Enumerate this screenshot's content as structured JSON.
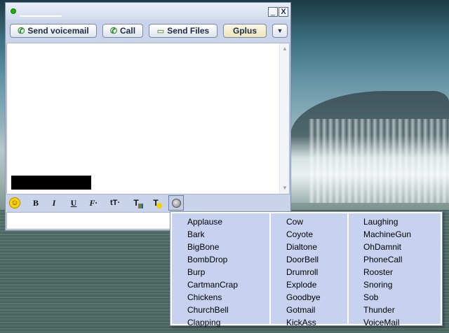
{
  "window": {
    "status": "online",
    "buttons": {
      "voicemail": "Send voicemail",
      "call": "Call",
      "files": "Send Files",
      "gplus": "Gplus",
      "more": "▼"
    },
    "window_controls": {
      "minimize": "_",
      "close": "X"
    }
  },
  "format_bar": {
    "bold": "B",
    "italic": "I",
    "underline": "U",
    "font": "F",
    "size": "tT",
    "text_color": "T",
    "bg_color": "T"
  },
  "sound_menu": {
    "col1": [
      "Applause",
      "Bark",
      "BigBone",
      "BombDrop",
      "Burp",
      "CartmanCrap",
      "Chickens",
      "ChurchBell",
      "Clapping"
    ],
    "col2": [
      "Cow",
      "Coyote",
      "Dialtone",
      "DoorBell",
      "Drumroll",
      "Explode",
      "Goodbye",
      "Gotmail",
      "KickAss"
    ],
    "col3": [
      "Laughing",
      "MachineGun",
      "OhDamnit",
      "PhoneCall",
      "Rooster",
      "Snoring",
      "Sob",
      "Thunder",
      "VoiceMail"
    ]
  }
}
